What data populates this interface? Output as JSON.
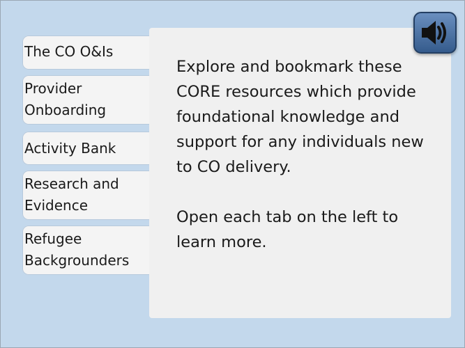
{
  "tabs": [
    {
      "lines": [
        "The CO O&Is"
      ]
    },
    {
      "lines": [
        "Provider",
        "Onboarding"
      ]
    },
    {
      "lines": [
        "Activity Bank"
      ]
    },
    {
      "lines": [
        "Research and",
        "Evidence"
      ]
    },
    {
      "lines": [
        "Refugee",
        "Backgrounders"
      ]
    }
  ],
  "main": {
    "paragraph_1": "Explore and bookmark these CORE resources which provide foundational knowledge and support for any individuals new to CO delivery.",
    "paragraph_2": "Open each tab on the left to learn more."
  },
  "audio_button": {
    "icon": "speaker-volume-icon"
  },
  "colors": {
    "background": "#c3d8ec",
    "panel": "#f0f0f0",
    "tab": "#f4f4f4",
    "audio_button": "#4a72a5",
    "text": "#1a1a1a"
  }
}
